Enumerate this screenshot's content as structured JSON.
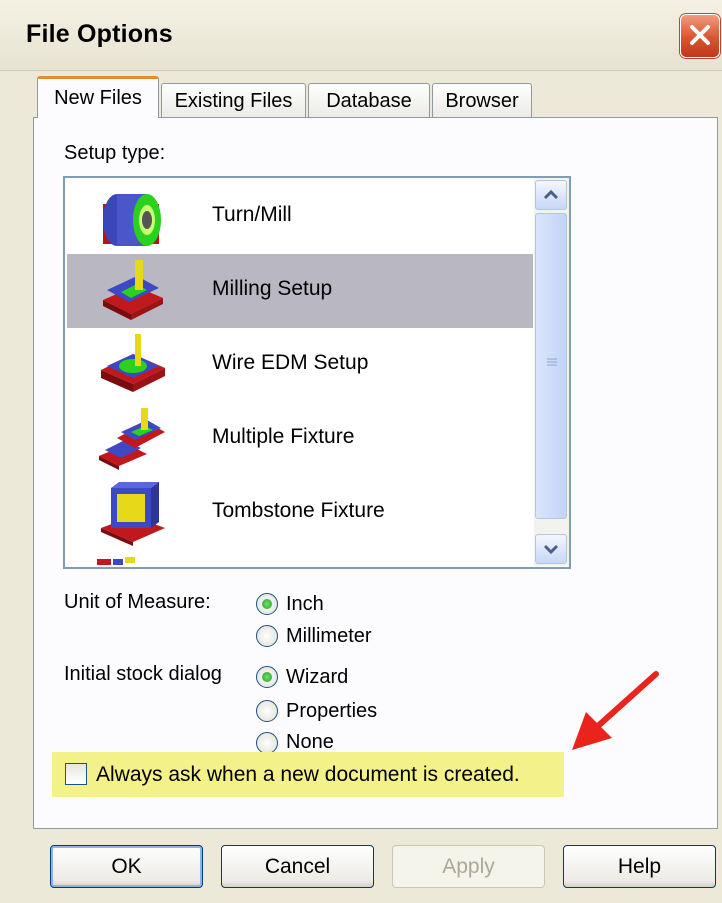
{
  "window": {
    "title": "File Options"
  },
  "tabs": [
    {
      "label": "New Files",
      "active": true
    },
    {
      "label": "Existing Files",
      "active": false
    },
    {
      "label": "Database",
      "active": false
    },
    {
      "label": "Browser",
      "active": false
    }
  ],
  "setup": {
    "label": "Setup type:",
    "items": [
      {
        "label": "Turn/Mill",
        "icon": "turn-mill-icon"
      },
      {
        "label": "Milling Setup",
        "icon": "milling-setup-icon",
        "selected": true
      },
      {
        "label": "Wire EDM Setup",
        "icon": "wire-edm-icon"
      },
      {
        "label": "Multiple Fixture",
        "icon": "multiple-fixture-icon"
      },
      {
        "label": "Tombstone Fixture",
        "icon": "tombstone-fixture-icon"
      }
    ]
  },
  "unit": {
    "label": "Unit of Measure:",
    "options": [
      "Inch",
      "Millimeter"
    ],
    "selected": "Inch"
  },
  "stock": {
    "label": "Initial stock dialog",
    "options": [
      "Wizard",
      "Properties",
      "None"
    ],
    "selected": "Wizard"
  },
  "always_ask": {
    "label": "Always ask when a new document is created.",
    "checked": false
  },
  "buttons": {
    "ok": "OK",
    "cancel": "Cancel",
    "apply": "Apply",
    "help": "Help"
  },
  "colors": {
    "highlight": "#f3f189",
    "selected_row": "#b9b8c2",
    "annotation_arrow": "#e8241c",
    "active_tab_accent": "#e68b2c"
  }
}
